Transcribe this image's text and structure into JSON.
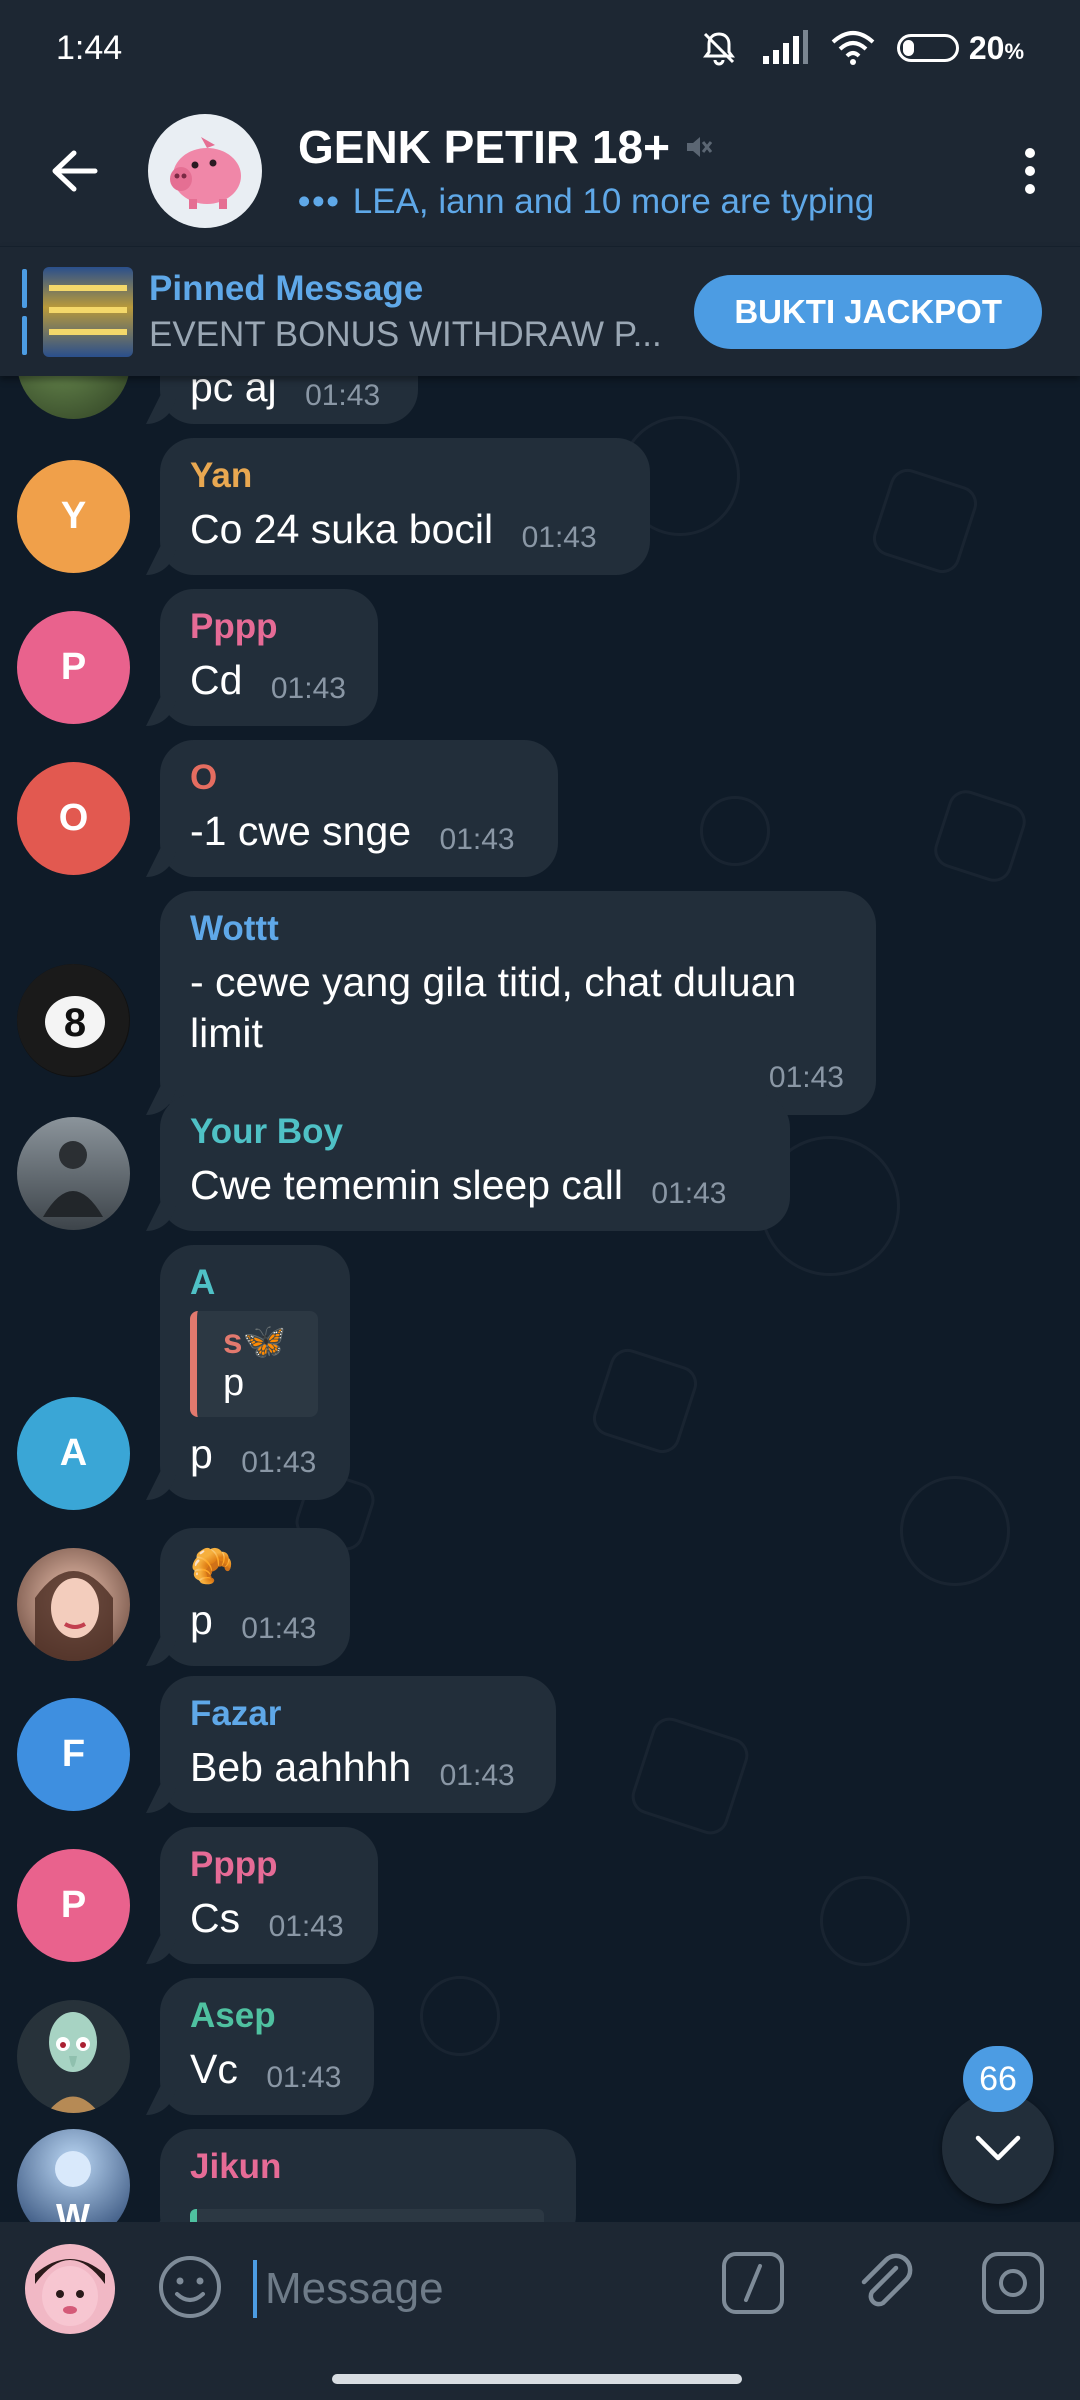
{
  "status": {
    "time": "1:44",
    "battery": "20",
    "battery_unit": "%",
    "battery_level": 0.2
  },
  "header": {
    "title": "GENK PETIR 18+",
    "typing": "LEA, iann and 10 more are typing",
    "muted": true
  },
  "pinned": {
    "title": "Pinned Message",
    "preview": "EVENT BONUS WITHDRAW P...",
    "button_label": "BUKTI JACKPOT"
  },
  "messages": [
    {
      "sender": "",
      "text": "pc aj",
      "time": "01:43",
      "avatar": "photo-plant"
    },
    {
      "sender": "Yan",
      "sender_color": "#e9a851",
      "avatar_letter": "Y",
      "avatar_color": "#f0a04a",
      "text": "Co 24 suka bocil",
      "time": "01:43"
    },
    {
      "sender": "Pppp",
      "sender_color": "#e66b96",
      "avatar_letter": "P",
      "avatar_color": "#e9628d",
      "text": "Cd",
      "time": "01:43"
    },
    {
      "sender": "O",
      "sender_color": "#e56d60",
      "avatar_letter": "O",
      "avatar_color": "#e25950",
      "text": "-1 cwe snge",
      "time": "01:43"
    },
    {
      "sender": "Wottt",
      "sender_color": "#5fa8e8",
      "avatar": "8-ball",
      "text": "- cewe yang gila titid, chat duluan limit",
      "time": "01:43"
    },
    {
      "sender": "Your Boy",
      "sender_color": "#4fc1c6",
      "avatar": "photo-person",
      "text": "Cwe tememin sleep call",
      "time": "01:43"
    },
    {
      "sender": "A",
      "sender_color": "#4fc1c6",
      "avatar_letter": "A",
      "avatar_color": "#3aa6d6",
      "reply_name": "s🦋",
      "reply_text": "p",
      "text": "p",
      "time": "01:43"
    },
    {
      "sender_emoji": "🥐",
      "avatar": "photo-girl",
      "text": "p",
      "time": "01:43"
    },
    {
      "sender": "Fazar",
      "sender_color": "#5fa8e8",
      "avatar_letter": "F",
      "avatar_color": "#3e8fe0",
      "text": "Beb aahhhh",
      "time": "01:43"
    },
    {
      "sender": "Pppp",
      "sender_color": "#e66b96",
      "avatar_letter": "P",
      "avatar_color": "#e9628d",
      "text": "Cs",
      "time": "01:43"
    },
    {
      "sender": "Asep",
      "sender_color": "#4fc1a0",
      "avatar": "squidward",
      "text": "Vc",
      "time": "01:43"
    },
    {
      "sender": "Jikun",
      "sender_color": "#e66b96",
      "avatar": "photo-blue-w",
      "text": "",
      "time": ""
    }
  ],
  "scroll": {
    "unread_count": "66"
  },
  "input": {
    "placeholder": "Message"
  },
  "icons": {
    "back": "arrow-left-icon",
    "menu": "more-vertical-icon",
    "emoji": "emoji-icon",
    "commands": "slash-command-icon",
    "attach": "paperclip-icon",
    "camera": "camera-icon",
    "scroll_down": "chevron-down-icon"
  }
}
